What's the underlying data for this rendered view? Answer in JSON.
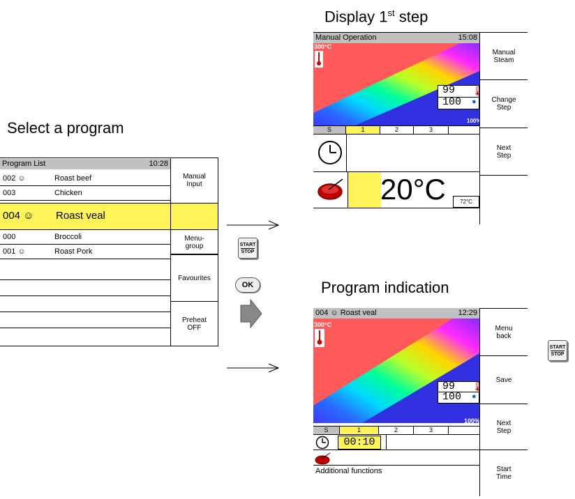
{
  "captions": {
    "select": "Select a program",
    "display_main": "Display 1",
    "display_sup": "st",
    "display_rest": " step",
    "program_indication": "Program indication"
  },
  "program_list": {
    "title": "Program List",
    "time": "10:28",
    "rows": [
      {
        "num": "002 ☺",
        "name": "Roast beef"
      },
      {
        "num": "003",
        "name": "Chicken"
      },
      {
        "num": "004  ☺",
        "name": "Roast veal"
      },
      {
        "num": "000",
        "name": "Broccoli"
      },
      {
        "num": "001 ☺",
        "name": "Roast Pork"
      }
    ],
    "buttons": [
      "Manual\nInput",
      "Menu-\ngroup",
      "Favourites",
      "Preheat\nOFF"
    ]
  },
  "keys": {
    "start": "START",
    "stop": "STOP",
    "ok": "OK"
  },
  "display_step": {
    "title": "Manual Operation",
    "time": "15:08",
    "temp_max": "300°C",
    "readout_temp": "99",
    "readout_humidity": "100",
    "percent": "100%",
    "tabs": [
      "S",
      "1",
      "2",
      "3"
    ],
    "big_temp": "20°C",
    "core_temp": "72°C",
    "buttons": [
      "Manual\nSteam",
      "Change\nStep",
      "Next\nStep",
      ""
    ]
  },
  "program_ind": {
    "title": "004 ☺   Roast veal",
    "time": "12:29",
    "temp_max": "300°C",
    "readout_temp": "99",
    "readout_humidity": "100",
    "percent": "100%",
    "tabs": [
      "S",
      "1",
      "2",
      "3"
    ],
    "timer": "00:10",
    "footer": "Additional functions",
    "buttons": [
      "Menu\nback",
      "Save",
      "Next\nStep",
      "Start\nTime"
    ]
  },
  "colors": {
    "highlight": "#fff35a",
    "heat": "#ff5a5a",
    "titlebar": "#c0c0c0"
  },
  "icons": [
    "thermometer-icon",
    "clock-icon",
    "meat-icon",
    "arrow-right-icon",
    "humidity-icon"
  ]
}
